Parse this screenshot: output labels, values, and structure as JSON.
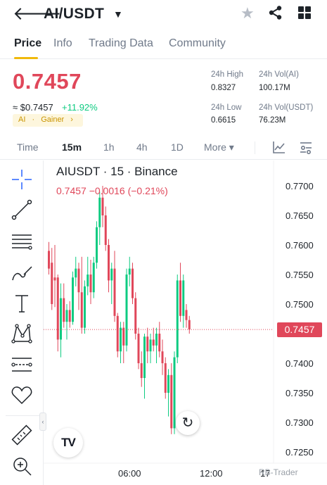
{
  "header": {
    "pair": "AI/USDT"
  },
  "tabs": [
    {
      "label": "Price",
      "active": true
    },
    {
      "label": "Info",
      "active": false
    },
    {
      "label": "Trading Data",
      "active": false
    },
    {
      "label": "Community",
      "active": false
    }
  ],
  "ticker": {
    "price": "0.7457",
    "fiat": "≈ $0.7457",
    "change": "+11.92%",
    "tags": [
      "AI",
      "Gainer"
    ],
    "stats": {
      "high_label": "24h High",
      "high": "0.8327",
      "low_label": "24h Low",
      "low": "0.6615",
      "vol_base_label": "24h Vol(AI)",
      "vol_base": "100.17M",
      "vol_quote_label": "24h Vol(USDT)",
      "vol_quote": "76.23M"
    }
  },
  "intervals": [
    {
      "label": "Time",
      "active": false
    },
    {
      "label": "15m",
      "active": true
    },
    {
      "label": "1h",
      "active": false
    },
    {
      "label": "4h",
      "active": false
    },
    {
      "label": "1D",
      "active": false
    },
    {
      "label": "More",
      "active": false
    }
  ],
  "chart": {
    "title": "AIUSDT · 15 · Binance",
    "ohlc": "0.7457  −0.0016 (−0.21%)",
    "last_price": "0.7457",
    "watermark": "RB-Trader",
    "colors": {
      "up": "#0ecb81",
      "down": "#e0475a"
    }
  },
  "chart_data": {
    "type": "candlestick",
    "title": "AIUSDT · 15 · Binance",
    "ylim": [
      0.7225,
      0.7725
    ],
    "y_ticks": [
      "0.7700",
      "0.7650",
      "0.7600",
      "0.7550",
      "0.7500",
      "0.7450",
      "0.7400",
      "0.7350",
      "0.7300",
      "0.7250"
    ],
    "x_ticks": [
      "06:00",
      "12:00",
      "17"
    ],
    "candles": [
      [
        0.759,
        0.7605,
        0.755,
        0.756
      ],
      [
        0.757,
        0.7595,
        0.749,
        0.75
      ],
      [
        0.7545,
        0.76,
        0.7495,
        0.754
      ],
      [
        0.7545,
        0.755,
        0.742,
        0.744
      ],
      [
        0.744,
        0.7535,
        0.741,
        0.751
      ],
      [
        0.751,
        0.7535,
        0.746,
        0.747
      ],
      [
        0.747,
        0.75,
        0.744,
        0.749
      ],
      [
        0.749,
        0.7505,
        0.746,
        0.747
      ],
      [
        0.747,
        0.7555,
        0.7465,
        0.7545
      ],
      [
        0.7545,
        0.758,
        0.753,
        0.756
      ],
      [
        0.756,
        0.757,
        0.749,
        0.752
      ],
      [
        0.752,
        0.758,
        0.745,
        0.746
      ],
      [
        0.746,
        0.754,
        0.745,
        0.753
      ],
      [
        0.753,
        0.758,
        0.7515,
        0.755
      ],
      [
        0.755,
        0.7575,
        0.75,
        0.752
      ],
      [
        0.752,
        0.758,
        0.751,
        0.757
      ],
      [
        0.757,
        0.764,
        0.756,
        0.763
      ],
      [
        0.763,
        0.769,
        0.76,
        0.768
      ],
      [
        0.768,
        0.77,
        0.763,
        0.765
      ],
      [
        0.765,
        0.7665,
        0.759,
        0.76
      ],
      [
        0.76,
        0.761,
        0.752,
        0.754
      ],
      [
        0.754,
        0.757,
        0.75,
        0.756
      ],
      [
        0.756,
        0.759,
        0.747,
        0.748
      ],
      [
        0.748,
        0.7485,
        0.741,
        0.742
      ],
      [
        0.742,
        0.747,
        0.74,
        0.746
      ],
      [
        0.746,
        0.747,
        0.74,
        0.743
      ],
      [
        0.743,
        0.756,
        0.742,
        0.755
      ],
      [
        0.755,
        0.758,
        0.753,
        0.756
      ],
      [
        0.756,
        0.757,
        0.75,
        0.751
      ],
      [
        0.751,
        0.752,
        0.744,
        0.745
      ],
      [
        0.745,
        0.746,
        0.739,
        0.74
      ],
      [
        0.74,
        0.742,
        0.736,
        0.7375
      ],
      [
        0.7375,
        0.745,
        0.734,
        0.7445
      ],
      [
        0.7445,
        0.746,
        0.74,
        0.742
      ],
      [
        0.742,
        0.745,
        0.74,
        0.744
      ],
      [
        0.744,
        0.746,
        0.742,
        0.743
      ],
      [
        0.743,
        0.746,
        0.74,
        0.745
      ],
      [
        0.745,
        0.747,
        0.741,
        0.742
      ],
      [
        0.742,
        0.744,
        0.738,
        0.74
      ],
      [
        0.74,
        0.741,
        0.734,
        0.735
      ],
      [
        0.735,
        0.739,
        0.731,
        0.738
      ],
      [
        0.738,
        0.74,
        0.728,
        0.729
      ],
      [
        0.729,
        0.742,
        0.728,
        0.741
      ],
      [
        0.741,
        0.755,
        0.74,
        0.754
      ],
      [
        0.754,
        0.757,
        0.747,
        0.748
      ],
      [
        0.748,
        0.755,
        0.746,
        0.754
      ],
      [
        0.749,
        0.75,
        0.746,
        0.7473
      ],
      [
        0.7473,
        0.748,
        0.745,
        0.7457
      ]
    ]
  }
}
